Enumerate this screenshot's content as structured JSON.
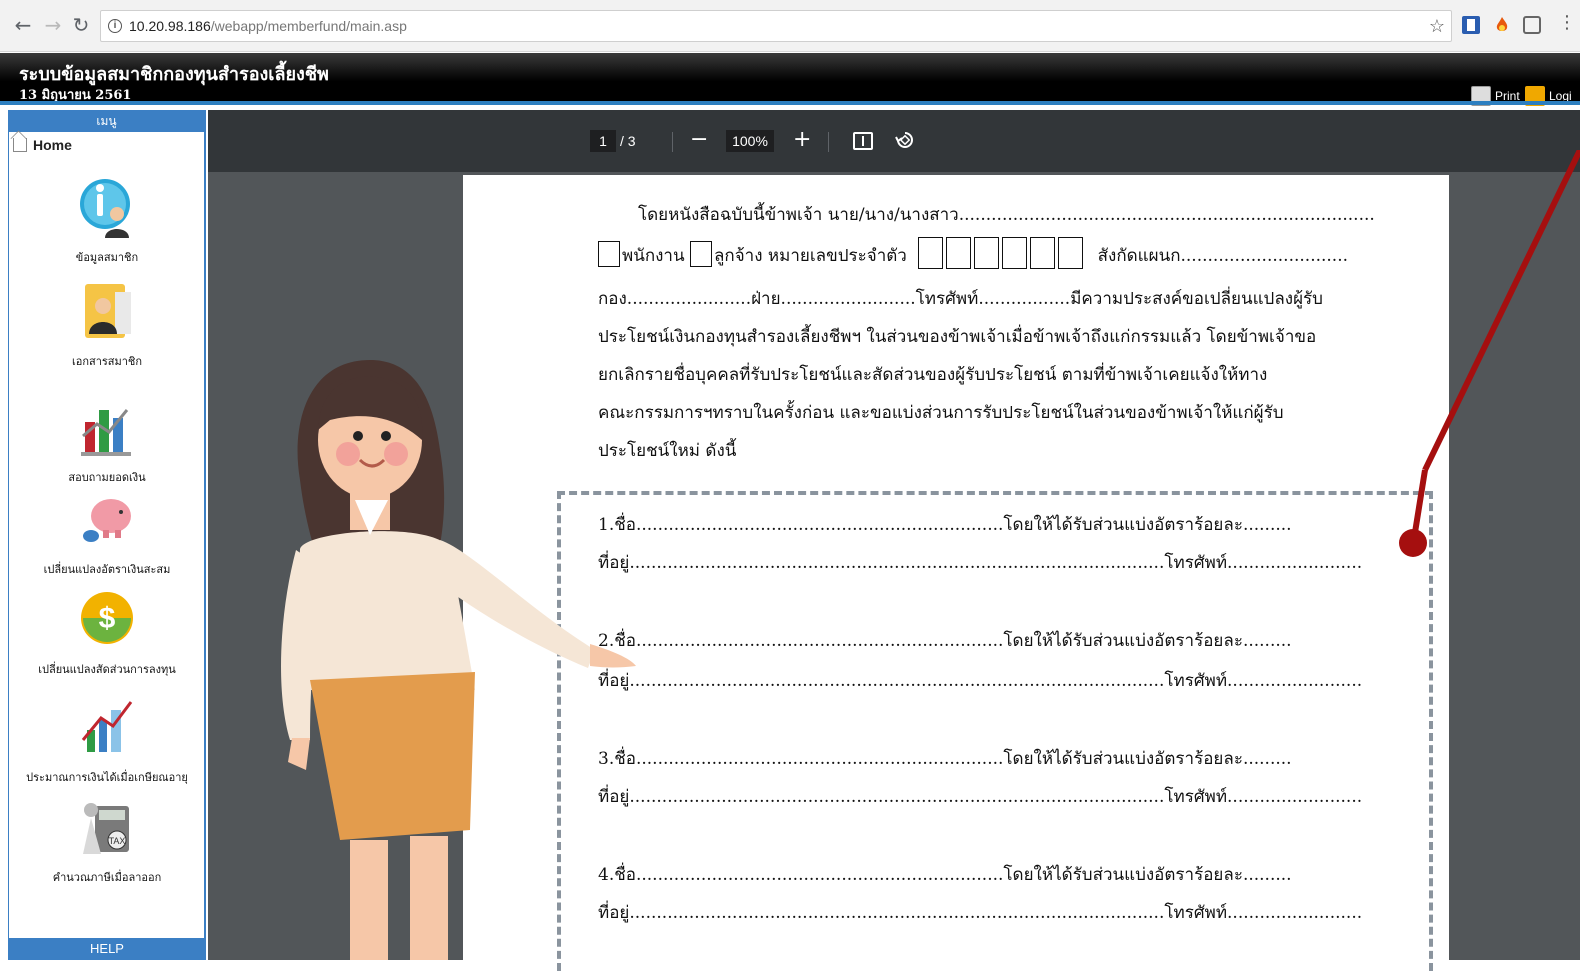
{
  "browser": {
    "url_host": "10.20.98.186",
    "url_path": "/webapp/memberfund/main.asp"
  },
  "app": {
    "title": "ระบบข้อมูลสมาชิกกองทุนสำรองเลี้ยงชีพ",
    "date": "13 มิถุนายน 2561",
    "print_label": "Print",
    "login_label": "Logi"
  },
  "sidebar": {
    "header": "เมนู",
    "home": "Home",
    "items": [
      {
        "label": "ข้อมูลสมาชิก",
        "icon": "info-person-icon"
      },
      {
        "label": "เอกสารสมาชิก",
        "icon": "document-person-icon"
      },
      {
        "label": "สอบถามยอดเงิน",
        "icon": "bar-chart-icon"
      },
      {
        "label": "เปลี่ยนแปลงอัตราเงินสะสม",
        "icon": "piggy-bank-icon"
      },
      {
        "label": "เปลี่ยนแปลงสัดส่วนการลงทุน",
        "icon": "dollar-coin-icon"
      },
      {
        "label": "ประมาณการเงินได้เมื่อเกษียณอายุ",
        "icon": "growth-chart-icon"
      },
      {
        "label": "คำนวณภาษีเมื่อลาออก",
        "icon": "tax-calculator-icon"
      }
    ],
    "help": "HELP"
  },
  "pdf_toolbar": {
    "page_current": "1",
    "page_total": "/ 3",
    "zoom": "100%"
  },
  "document": {
    "line1": "โดยหนังสือฉบับนี้ข้าพเจ้า นาย/นาง/นางสาว.............................................................................",
    "line2a": "พนักงาน",
    "line2b": "ลูกจ้าง หมายเลขประจำตัว",
    "line2c": "สังกัดแผนก...............................",
    "line3": "กอง.......................ฝ่าย.........................โทรศัพท์.................มีความประสงค์ขอเปลี่ยนแปลงผู้รับ",
    "line4": "ประโยชน์เงินกองทุนสำรองเลี้ยงชีพฯ ในส่วนของข้าพเจ้าเมื่อข้าพเจ้าถึงแก่กรรมแล้ว โดยข้าพเจ้าขอ",
    "line5": "ยกเลิกรายชื่อบุคคลที่รับประโยชน์และสัดส่วนของผู้รับประโยชน์ ตามที่ข้าพเจ้าเคยแจ้งให้ทาง",
    "line6": "คณะกรรมการฯทราบในครั้งก่อน และขอแบ่งส่วนการรับประโยชน์ในส่วนของข้าพเจ้าให้แก่ผู้รับ",
    "line7": "ประโยชน์ใหม่ ดังนี้",
    "beneficiaries": [
      {
        "name": "1.ชื่อ....................................................................โดยให้ได้รับส่วนแบ่งอัตราร้อยละ.........",
        "address": "ที่อยู่...................................................................................................โทรศัพท์........................."
      },
      {
        "name": "2.ชื่อ....................................................................โดยให้ได้รับส่วนแบ่งอัตราร้อยละ.........",
        "address": "ที่อยู่...................................................................................................โทรศัพท์........................."
      },
      {
        "name": "3.ชื่อ....................................................................โดยให้ได้รับส่วนแบ่งอัตราร้อยละ.........",
        "address": "ที่อยู่...................................................................................................โทรศัพท์........................."
      },
      {
        "name": "4.ชื่อ....................................................................โดยให้ได้รับส่วนแบ่งอัตราร้อยละ.........",
        "address": "ที่อยู่...................................................................................................โทรศัพท์........................."
      }
    ]
  },
  "colors": {
    "accent_blue": "#3b7fc4",
    "viewer_bg": "#525659",
    "toolbar_bg": "#323639",
    "pointer_red": "#a50f0f"
  }
}
